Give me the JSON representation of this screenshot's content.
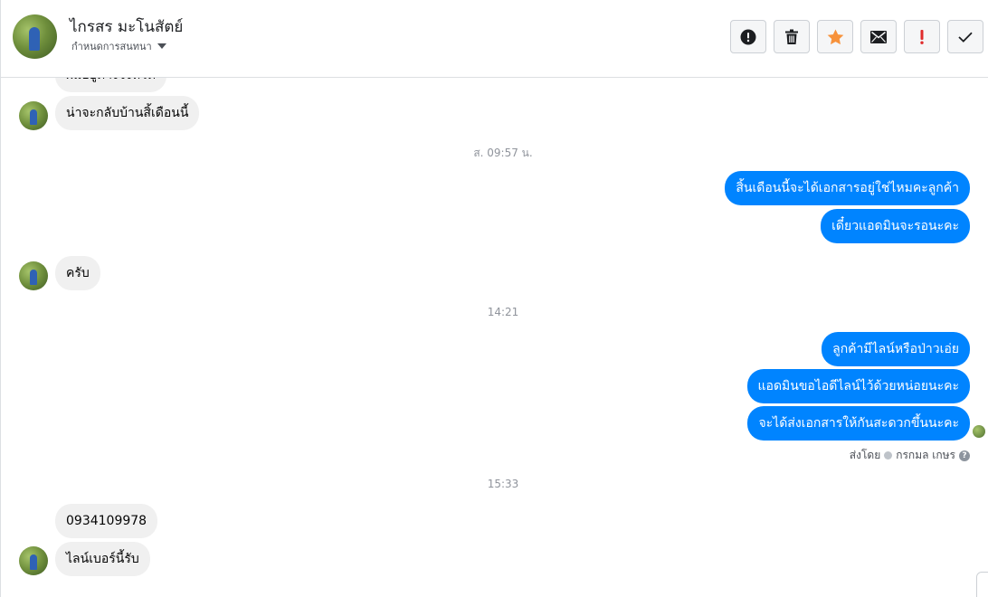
{
  "header": {
    "name": "ไกรสร มะโนสัตย์",
    "subtitle": "กำหนดการสนทนา",
    "actions": [
      {
        "icon": "exclamation-circle-icon"
      },
      {
        "icon": "trash-icon"
      },
      {
        "icon": "star-icon",
        "color": "#f7923b"
      },
      {
        "icon": "envelope-icon"
      },
      {
        "icon": "important-icon",
        "color": "#e02c2c"
      },
      {
        "icon": "checkmark-icon"
      }
    ]
  },
  "chat": {
    "partial_top": "ผมอยู่ต่างจังหวัด",
    "messages": [
      {
        "side": "in",
        "text": "น่าจะกลับบ้านสิ้เดือนนี้"
      },
      {
        "type": "timestamp",
        "text": "ส. 09:57 น."
      },
      {
        "side": "out",
        "text": "สิ้นเดือนนี้จะได้เอกสารอยู่ใช่ไหมคะลูกค้า"
      },
      {
        "side": "out",
        "text": "เดี๋ยวแอดมินจะรอนะคะ"
      },
      {
        "side": "in",
        "text": "ครับ"
      },
      {
        "type": "timestamp",
        "text": "14:21"
      },
      {
        "side": "out",
        "text": "ลูกค้ามีไลน์หรือป่าวเอ่ย"
      },
      {
        "side": "out",
        "text": "แอดมินขอไอดีไลน์ไว้ด้วยหน่อยนะคะ"
      },
      {
        "side": "out",
        "text": "จะได้ส่งเอกสารให้กันสะดวกขึ้นนะคะ"
      },
      {
        "type": "timestamp",
        "text": "15:33"
      },
      {
        "side": "in",
        "text": "0934109978"
      },
      {
        "side": "in",
        "text": "ไลน์เบอร์นี้รับ"
      }
    ],
    "sent_by_label": "ส่งโดย",
    "sent_by_name": "กรกมล เกษร",
    "help_icon": "?"
  },
  "colors": {
    "outgoing_bubble": "#0084ff",
    "incoming_bubble": "#f0f0f0"
  }
}
